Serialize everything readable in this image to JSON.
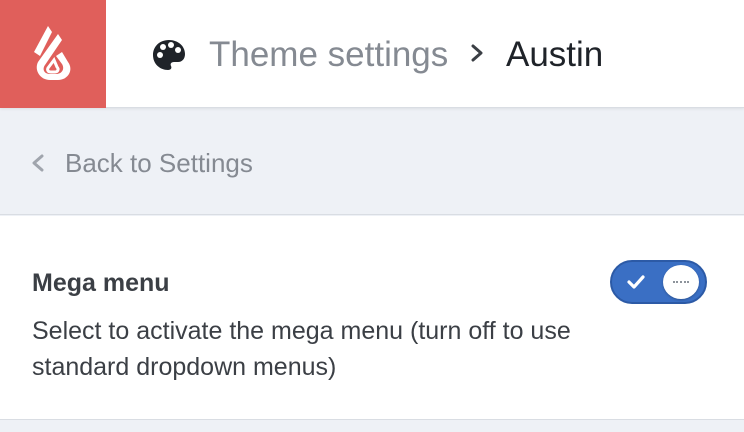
{
  "header": {
    "logo_icon": "lightspeed-flame-logo",
    "palette_icon": "palette-icon",
    "breadcrumb": {
      "parent": "Theme settings",
      "separator_icon": "chevron-right-icon",
      "current": "Austin"
    }
  },
  "back_bar": {
    "icon": "chevron-left-icon",
    "label": "Back to Settings"
  },
  "setting": {
    "title": "Mega menu",
    "description": "Select to activate the mega menu (turn off to use standard dropdown menus)",
    "toggle": {
      "checked": true,
      "accent": "#3a6fc4"
    }
  },
  "colors": {
    "brand": "#e05f5b",
    "text_muted": "#858a92",
    "text_dark": "#1f2329",
    "page_bg": "#eef1f6"
  }
}
